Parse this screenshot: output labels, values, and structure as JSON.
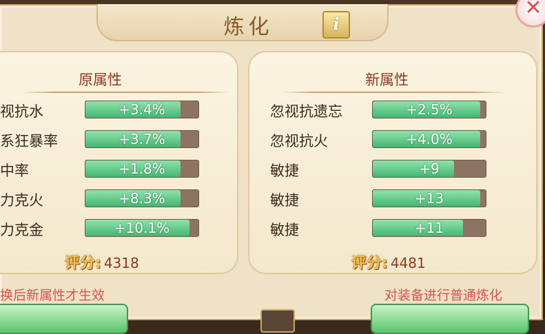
{
  "window": {
    "title": "炼化",
    "info_label": "i",
    "close_label": "✕"
  },
  "left_panel": {
    "header": "原属性",
    "rows": [
      {
        "label": "视抗水",
        "value": "+3.4%",
        "fill": 0.84
      },
      {
        "label": "系狂暴率",
        "value": "+3.7%",
        "fill": 0.84
      },
      {
        "label": "中率",
        "value": "+1.8%",
        "fill": 0.84
      },
      {
        "label": "力克火",
        "value": "+8.3%",
        "fill": 0.84
      },
      {
        "label": "力克金",
        "value": "+10.1%",
        "fill": 0.92
      }
    ],
    "score_label": "评分:",
    "score_value": "4318",
    "note": "换后新属性才生效"
  },
  "right_panel": {
    "header": "新属性",
    "rows": [
      {
        "label": "忽视抗遗忘",
        "value": "+2.5%",
        "fill": 0.95
      },
      {
        "label": "忽视抗火",
        "value": "+4.0%",
        "fill": 0.95
      },
      {
        "label": "敏捷",
        "value": "+9",
        "fill": 0.72
      },
      {
        "label": "敏捷",
        "value": "+13",
        "fill": 0.95
      },
      {
        "label": "敏捷",
        "value": "+11",
        "fill": 0.8
      }
    ],
    "score_label": "评分:",
    "score_value": "4481",
    "note": "对装备进行普通炼化"
  },
  "colors": {
    "accent": "#8b3a1f",
    "bar_fill": "#44b672",
    "bar_track": "#8d7462",
    "note": "#d9534f"
  }
}
